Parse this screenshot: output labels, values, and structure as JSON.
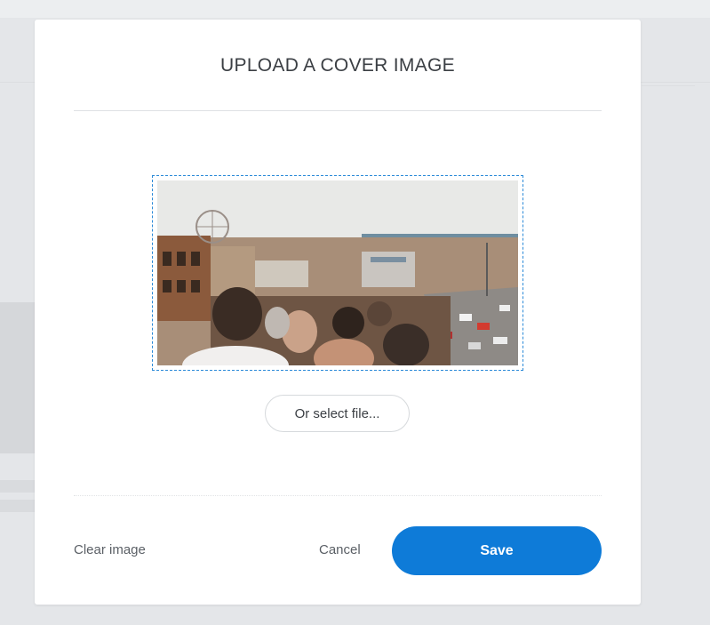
{
  "modal": {
    "title": "UPLOAD A COVER IMAGE",
    "preview_image": "boardwalk-pier-crowd-photo",
    "select_file_label": "Or select file...",
    "clear_label": "Clear image",
    "cancel_label": "Cancel",
    "save_label": "Save"
  },
  "colors": {
    "accent": "#0e7bd8",
    "dropzone_border": "#2b8ad8",
    "overlay": "#e4e6e9"
  }
}
